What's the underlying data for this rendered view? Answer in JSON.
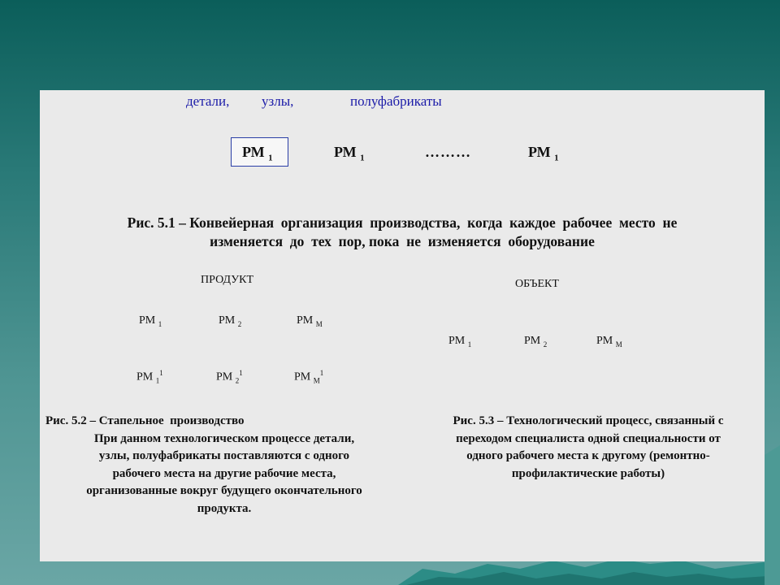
{
  "fig1": {
    "inputs": [
      "детали,",
      "узлы,",
      "полуфабрикаты"
    ],
    "stations": [
      {
        "label": "РМ",
        "sub": "1"
      },
      {
        "label": "РМ",
        "sub": "1"
      },
      {
        "label": "………"
      },
      {
        "label": "РМ",
        "sub": "1"
      }
    ],
    "caption_line1": "Рис. 5.1 – Конвейерная  организация  производства,  когда  каждое  рабочее  место  не",
    "caption_line2": "изменяется  до  тех  пор, пока  не  изменяется  оборудование"
  },
  "fig2": {
    "title": "ПРОДУКТ",
    "row1": [
      {
        "label": "РМ",
        "sub": "1"
      },
      {
        "label": "РМ",
        "sub": "2"
      },
      {
        "label": "РМ",
        "sub": "М"
      }
    ],
    "row2": [
      {
        "label": "РМ",
        "sub": "1",
        "sup": "1"
      },
      {
        "label": "РМ",
        "sub": "2",
        "sup": "1"
      },
      {
        "label": "РМ",
        "sub": "М",
        "sup": "1"
      }
    ],
    "caption_title": "Рис. 5.2 – Стапельное  производство",
    "caption_body": [
      "При данном технологическом процессе детали,",
      "узлы, полуфабрикаты поставляются с одного",
      "рабочего места на другие рабочие места,",
      "организованные вокруг будущего окончательного",
      "продукта."
    ]
  },
  "fig3": {
    "title": "ОБЪЕКТ",
    "row": [
      {
        "label": "РМ",
        "sub": "1"
      },
      {
        "label": "РМ",
        "sub": "2"
      },
      {
        "label": "РМ",
        "sub": "М"
      }
    ],
    "caption": [
      "Рис. 5.3 – Технологический процесс, связанный с",
      "переходом специалиста одной специальности от",
      "одного рабочего места к другому (ремонтно-",
      "профилактические работы)"
    ]
  },
  "colors": {
    "accent_text": "#1b1ba8",
    "box_border": "#2a3ea6",
    "panel": "#eaeaea"
  }
}
